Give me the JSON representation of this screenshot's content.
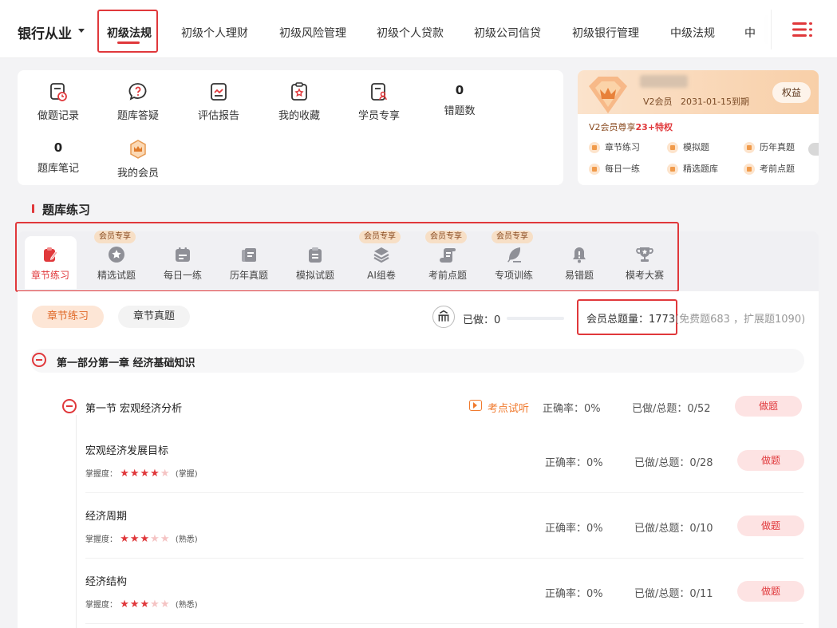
{
  "header": {
    "brand": "银行从业",
    "tabs": [
      "初级法规",
      "初级个人理财",
      "初级风险管理",
      "初级个人贷款",
      "初级公司信贷",
      "初级银行管理",
      "中级法规",
      "中"
    ],
    "active_tab": 0
  },
  "tools": {
    "row1": [
      {
        "label": "做题记录",
        "icon": "record-icon"
      },
      {
        "label": "题库答疑",
        "icon": "question-icon"
      },
      {
        "label": "评估报告",
        "icon": "report-icon"
      },
      {
        "label": "我的收藏",
        "icon": "favorite-icon"
      },
      {
        "label": "学员专享",
        "icon": "student-icon"
      },
      {
        "label": "错题数",
        "value": "0"
      }
    ],
    "row2": [
      {
        "label": "题库笔记",
        "value": "0"
      },
      {
        "label": "我的会员",
        "icon": "vip-icon"
      }
    ]
  },
  "vip": {
    "level": "V2会员",
    "expire": "2031-01-15到期",
    "rights_button": "权益",
    "privilege_prefix": "V2会员尊享",
    "privilege_highlight": "23+特权",
    "items": [
      "章节练习",
      "模拟题",
      "历年真题",
      "每日一练",
      "精选题库",
      "考前点题"
    ]
  },
  "section": {
    "title": "题库练习"
  },
  "practice_tabs": [
    {
      "label": "章节练习",
      "icon": "chapter-icon"
    },
    {
      "label": "精选试题",
      "icon": "star-badge-icon",
      "tag": "会员专享"
    },
    {
      "label": "每日一练",
      "icon": "calendar-icon"
    },
    {
      "label": "历年真题",
      "icon": "papers-icon"
    },
    {
      "label": "模拟试题",
      "icon": "clipboard-icon"
    },
    {
      "label": "AI组卷",
      "icon": "layers-icon",
      "tag": "会员专享"
    },
    {
      "label": "考前点题",
      "icon": "scroll-icon",
      "tag": "会员专享"
    },
    {
      "label": "专项训练",
      "icon": "feather-icon",
      "tag": "会员专享"
    },
    {
      "label": "易错题",
      "icon": "bell-icon"
    },
    {
      "label": "模考大赛",
      "icon": "trophy-icon"
    }
  ],
  "filter": {
    "pill_chapter": "章节练习",
    "pill_exam": "章节真题",
    "done_label": "已做：",
    "done_value": "0",
    "done_progress": 0,
    "total_label": "会员总题量：",
    "total_value": "1773",
    "total_extra": "(免费题683 ，扩展题1090)"
  },
  "chapter": {
    "title": "第一部分第一章 经济基础知识",
    "section": {
      "title": "第一节 宏观经济分析",
      "listen": "考点试听",
      "accuracy": "正确率：0%",
      "done": "已做/总题：0/52",
      "button": "做题"
    },
    "points": [
      {
        "title": "宏观经济发展目标",
        "mastery_label": "掌握度：",
        "stars": 4,
        "level": "(掌握)",
        "accuracy": "正确率：0%",
        "done": "已做/总题：0/28",
        "button": "做题"
      },
      {
        "title": "经济周期",
        "mastery_label": "掌握度：",
        "stars": 3,
        "level": "(熟悉)",
        "accuracy": "正确率：0%",
        "done": "已做/总题：0/10",
        "button": "做题"
      },
      {
        "title": "经济结构",
        "mastery_label": "掌握度：",
        "stars": 3,
        "level": "(熟悉)",
        "accuracy": "正确率：0%",
        "done": "已做/总题：0/11",
        "button": "做题"
      }
    ]
  },
  "colors": {
    "accent": "#e0383b",
    "orange": "#f07a2e",
    "vip": "#8a4b20"
  }
}
